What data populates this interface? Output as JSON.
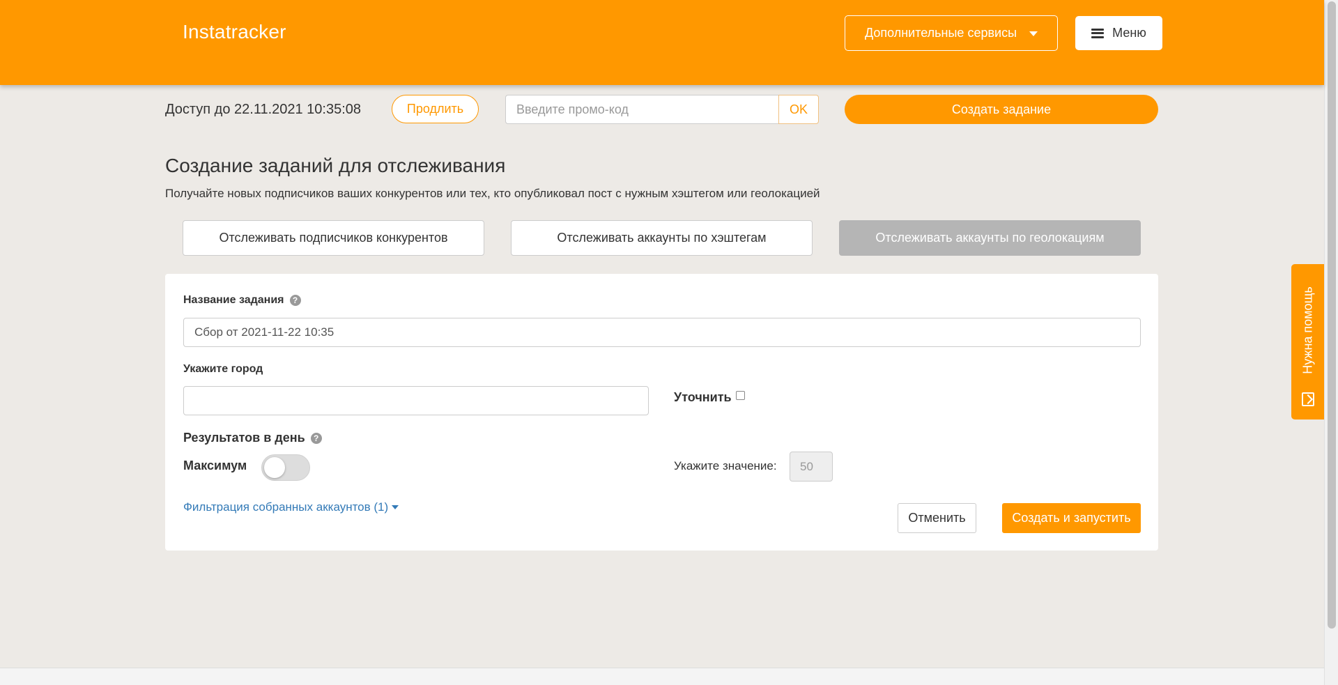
{
  "header": {
    "logo": "Instatracker",
    "services_label": "Дополнительные сервисы",
    "menu_label": "Меню"
  },
  "access": {
    "text": "Доступ до 22.11.2021 10:35:08",
    "extend_label": "Продлить",
    "promo_placeholder": "Введите промо-код",
    "promo_ok_label": "OK",
    "create_task_label": "Создать задание"
  },
  "page": {
    "title": "Создание заданий для отслеживания",
    "subtitle": "Получайте новых подписчиков ваших конкурентов или тех, кто опубликовал пост с нужным хэштегом или геолокацией"
  },
  "modes": [
    {
      "label": "Отслеживать подписчиков конкурентов",
      "active": false
    },
    {
      "label": "Отслеживать аккаунты по хэштегам",
      "active": false
    },
    {
      "label": "Отслеживать аккаунты по геолокациям",
      "active": true
    }
  ],
  "form": {
    "task_name_label": "Название задания",
    "task_name_value": "Сбор от 2021-11-22 10:35",
    "city_label": "Укажите город",
    "city_value": "",
    "refine_label": "Уточнить",
    "refine_checked": false,
    "results_label": "Результатов в день",
    "max_label": "Максимум",
    "max_enabled": false,
    "value_label": "Укажите значение:",
    "value": "50",
    "filter_link": "Фильтрация собранных аккаунтов (1)",
    "cancel_label": "Отменить",
    "launch_label": "Создать и запустить"
  },
  "help_tab": {
    "label": "Нужна помощь"
  },
  "colors": {
    "accent": "#ff9800",
    "background": "#edeae6",
    "link": "#337ab7",
    "active_tab": "#b5b5b5"
  },
  "icons": {
    "services_caret": "chevron-down-icon",
    "menu": "hamburger-icon",
    "help": "question-circle-icon",
    "filter_caret": "caret-down-icon",
    "chat": "chat-icon"
  }
}
